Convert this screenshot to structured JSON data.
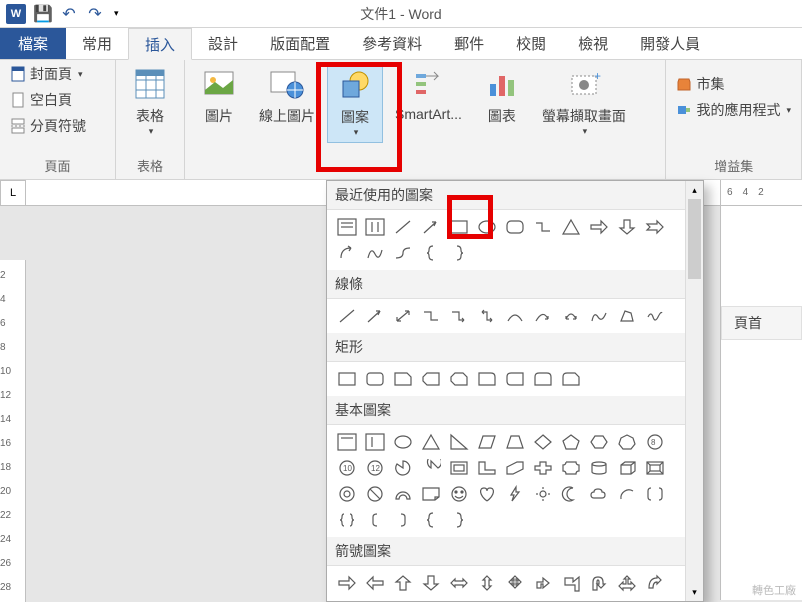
{
  "title": "文件1 - Word",
  "qat": {
    "save": "💾",
    "undo": "↶",
    "redo": "↷"
  },
  "tabs": {
    "file": "檔案",
    "home": "常用",
    "insert": "插入",
    "design": "設計",
    "layout": "版面配置",
    "references": "參考資料",
    "mail": "郵件",
    "review": "校閱",
    "view": "檢視",
    "developer": "開發人員"
  },
  "ribbon": {
    "pages": {
      "label": "頁面",
      "cover": "封面頁",
      "blank": "空白頁",
      "break": "分頁符號"
    },
    "tables": {
      "label": "表格",
      "btn": "表格"
    },
    "illus": {
      "pic": "圖片",
      "online": "線上圖片",
      "shapes": "圖案",
      "smartart": "SmartArt...",
      "chart": "圖表",
      "screenshot": "螢幕擷取畫面"
    },
    "addins": {
      "label": "增益集",
      "store": "市集",
      "my": "我的應用程式"
    }
  },
  "shapes_panel": {
    "recent": "最近使用的圖案",
    "lines": "線條",
    "rects": "矩形",
    "basic": "基本圖案",
    "arrows": "箭號圖案"
  },
  "side": {
    "ticks": [
      "6",
      "4",
      "2"
    ],
    "header": "頁首"
  },
  "ruler_v": [
    "2",
    "4",
    "6",
    "8",
    "10",
    "12",
    "14",
    "16",
    "18",
    "20",
    "22",
    "24",
    "26",
    "28"
  ],
  "corner": "L",
  "watermark": "轉色工廠"
}
